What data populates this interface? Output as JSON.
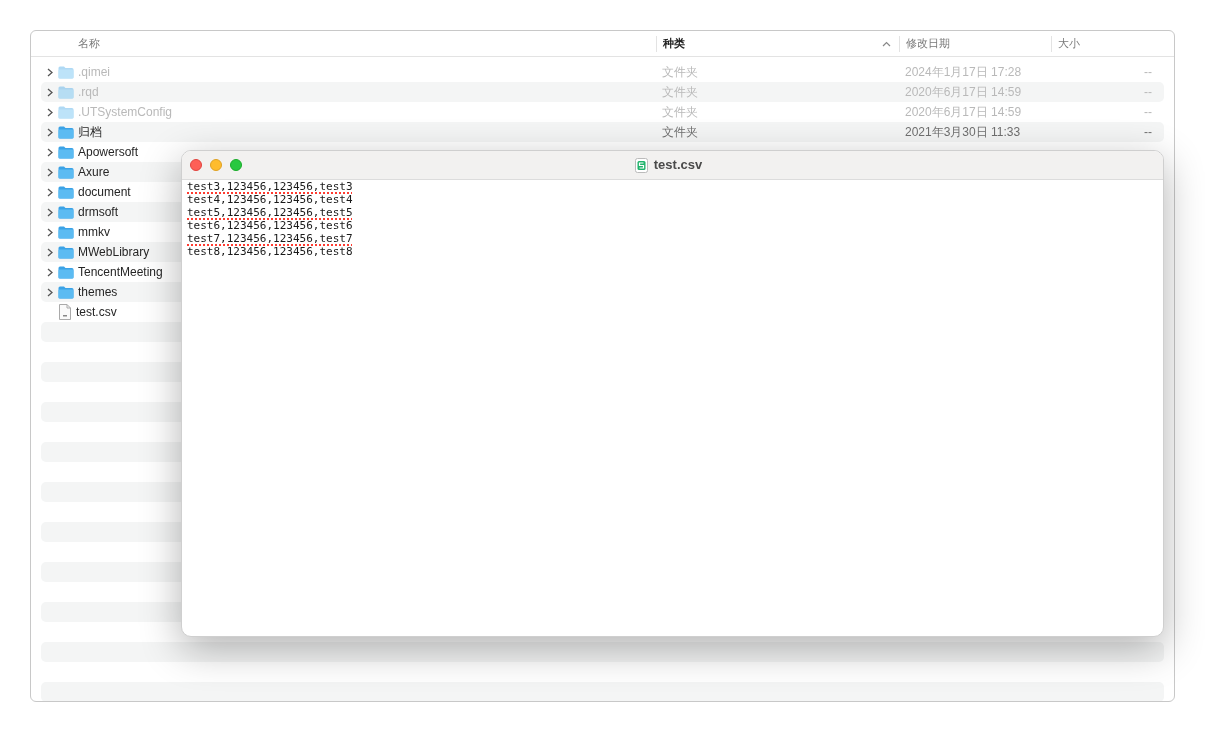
{
  "finder": {
    "columns": [
      {
        "label": "名称",
        "sorted": false
      },
      {
        "label": "种类",
        "sorted": true
      },
      {
        "label": "修改日期",
        "sorted": false
      },
      {
        "label": "大小",
        "sorted": false
      }
    ],
    "rows": [
      {
        "kind": "folder",
        "name": ".qimei",
        "type_label": "文件夹",
        "date": "2024年1月17日 17:28",
        "size": "--",
        "hidden": true
      },
      {
        "kind": "folder",
        "name": ".rqd",
        "type_label": "文件夹",
        "date": "2020年6月17日 14:59",
        "size": "--",
        "hidden": true
      },
      {
        "kind": "folder",
        "name": ".UTSystemConfig",
        "type_label": "文件夹",
        "date": "2020年6月17日 14:59",
        "size": "--",
        "hidden": true
      },
      {
        "kind": "folder",
        "name": "归档",
        "type_label": "文件夹",
        "date": "2021年3月30日 11:33",
        "size": "--",
        "hidden": false
      },
      {
        "kind": "folder",
        "name": "Apowersoft",
        "hidden": false
      },
      {
        "kind": "folder",
        "name": "Axure",
        "hidden": false
      },
      {
        "kind": "folder",
        "name": "document",
        "hidden": false
      },
      {
        "kind": "folder",
        "name": "drmsoft",
        "hidden": false
      },
      {
        "kind": "folder",
        "name": "mmkv",
        "hidden": false
      },
      {
        "kind": "folder",
        "name": "MWebLibrary",
        "hidden": false
      },
      {
        "kind": "folder",
        "name": "TencentMeeting",
        "hidden": false
      },
      {
        "kind": "folder",
        "name": "themes",
        "hidden": false
      },
      {
        "kind": "file",
        "name": "test.csv",
        "hidden": false
      }
    ]
  },
  "editor": {
    "title": "test.csv",
    "lines": [
      {
        "text": "test3,123456,123456,test3",
        "misspelled": true
      },
      {
        "text": "test4,123456,123456,test4",
        "misspelled": false
      },
      {
        "text": "test5,123456,123456,test5",
        "misspelled": true
      },
      {
        "text": "test6,123456,123456,test6",
        "misspelled": false
      },
      {
        "text": "test7,123456,123456,test7",
        "misspelled": true
      },
      {
        "text": "test8,123456,123456,test8",
        "misspelled": false
      }
    ]
  }
}
